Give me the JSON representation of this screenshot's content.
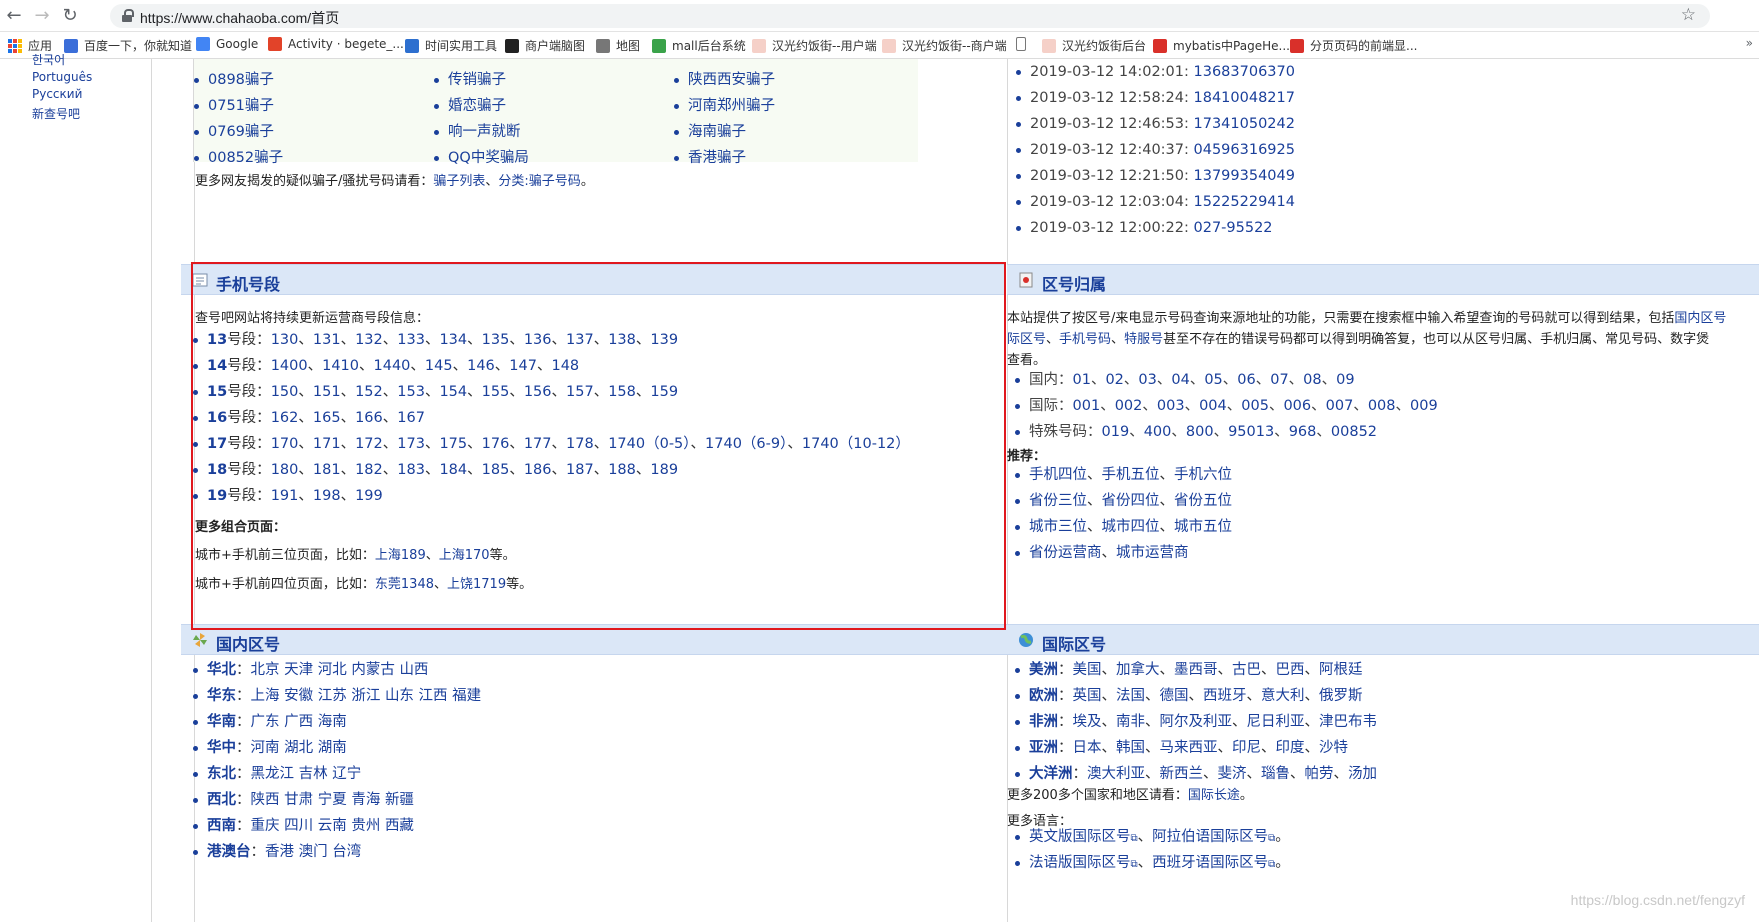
{
  "browser": {
    "url": "https://www.chahaoba.com/首页",
    "bookmarks": [
      "应用",
      "百度一下，你就知道",
      "Google",
      "Activity · begete_...",
      "时间实用工具",
      "商户端脑图",
      "地图",
      "mall后台系统",
      "汉光约饭街--用户端",
      "汉光约饭街--商户端",
      "",
      "汉光约饭街后台",
      "mybatis中PageHe...",
      "分页页码的前端显..."
    ],
    "more": "»"
  },
  "sidebar": {
    "languages": [
      "한국어",
      "Português",
      "Русский",
      "新查号吧"
    ]
  },
  "scam": {
    "col1": [
      "0898骗子",
      "0751骗子",
      "0769骗子",
      "00852骗子"
    ],
    "col2": [
      "传销骗子",
      "婚恋骗子",
      "响一声就断",
      "QQ中奖骗局"
    ],
    "col3": [
      "陕西西安骗子",
      "河南郑州骗子",
      "海南骗子",
      "香港骗子"
    ],
    "more_prefix": "更多网友揭发的疑似骗子/骚扰号码请看：",
    "more_link1": "骗子列表",
    "more_sep": "、",
    "more_link2": "分类:骗子号码",
    "more_suffix": "。"
  },
  "recent": {
    "items": [
      {
        "time": "2019-03-12 14:02:01:",
        "num": "13683706370"
      },
      {
        "time": "2019-03-12 12:58:24:",
        "num": "18410048217"
      },
      {
        "time": "2019-03-12 12:46:53:",
        "num": "17341050242"
      },
      {
        "time": "2019-03-12 12:40:37:",
        "num": "04596316925"
      },
      {
        "time": "2019-03-12 12:21:50:",
        "num": "13799354049"
      },
      {
        "time": "2019-03-12 12:03:04:",
        "num": "15225229414"
      },
      {
        "time": "2019-03-12 12:00:22:",
        "num": "027-95522"
      }
    ]
  },
  "mobile": {
    "title": "手机号段",
    "intro": "查号吧网站将持续更新运营商号段信息：",
    "segments": [
      {
        "key": "13",
        "label": "号段：",
        "values": [
          "130",
          "131",
          "132",
          "133",
          "134",
          "135",
          "136",
          "137",
          "138",
          "139"
        ]
      },
      {
        "key": "14",
        "label": "号段：",
        "values": [
          "1400",
          "1410",
          "1440",
          "145",
          "146",
          "147",
          "148"
        ]
      },
      {
        "key": "15",
        "label": "号段：",
        "values": [
          "150",
          "151",
          "152",
          "153",
          "154",
          "155",
          "156",
          "157",
          "158",
          "159"
        ]
      },
      {
        "key": "16",
        "label": "号段：",
        "values": [
          "162",
          "165",
          "166",
          "167"
        ]
      },
      {
        "key": "17",
        "label": "号段：",
        "values": [
          "170",
          "171",
          "172",
          "173",
          "175",
          "176",
          "177",
          "178",
          "1740（0-5）",
          "1740（6-9）",
          "1740（10-12）"
        ]
      },
      {
        "key": "18",
        "label": "号段：",
        "values": [
          "180",
          "181",
          "182",
          "183",
          "184",
          "185",
          "186",
          "187",
          "188",
          "189"
        ]
      },
      {
        "key": "19",
        "label": "号段：",
        "values": [
          "191",
          "198",
          "199"
        ]
      }
    ],
    "more_title": "更多组合页面：",
    "combo1_prefix": "城市+手机前三位页面，比如：",
    "combo1_link1": "上海189",
    "combo1_link2": "上海170",
    "combo1_suffix": "等。",
    "combo2_prefix": "城市+手机前四位页面，比如：",
    "combo2_link1": "东莞1348",
    "combo2_link2": "上饶1719",
    "combo2_suffix": "等。",
    "sep": "、"
  },
  "area": {
    "title": "区号归属",
    "desc1": "本站提供了按区号/来电显示号码查询来源地址的功能，只需要在搜索框中输入希望查询的号码就可以得到结果，包括",
    "desc1_link": "国内区号",
    "desc2_link1": "际区号",
    "desc2_sep1": "、",
    "desc2_link2": "手机号码",
    "desc2_sep2": "、",
    "desc2_link3": "特服号",
    "desc2_rest": "甚至不存在的错误号码都可以得到明确答复，也可以从区号归属、手机归属、常见号码、数字煲",
    "desc3": "查看。",
    "rows": [
      {
        "label": "国内：",
        "values": [
          "01",
          "02",
          "03",
          "04",
          "05",
          "06",
          "07",
          "08",
          "09"
        ]
      },
      {
        "label": "国际：",
        "values": [
          "001",
          "002",
          "003",
          "004",
          "005",
          "006",
          "007",
          "008",
          "009"
        ]
      },
      {
        "label": "特殊号码：",
        "values": [
          "019",
          "400",
          "800",
          "95013",
          "968",
          "00852"
        ]
      }
    ],
    "recommend_title": "推荐：",
    "recommend": [
      [
        "手机四位",
        "手机五位",
        "手机六位"
      ],
      [
        "省份三位",
        "省份四位",
        "省份五位"
      ],
      [
        "城市三位",
        "城市四位",
        "城市五位"
      ],
      [
        "省份运营商",
        "城市运营商"
      ]
    ]
  },
  "domestic": {
    "title": "国内区号",
    "regions": [
      {
        "key": "华北",
        "items": [
          "北京",
          "天津",
          "河北",
          "内蒙古",
          "山西"
        ]
      },
      {
        "key": "华东",
        "items": [
          "上海",
          "安徽",
          "江苏",
          "浙江",
          "山东",
          "江西",
          "福建"
        ]
      },
      {
        "key": "华南",
        "items": [
          "广东",
          "广西",
          "海南"
        ]
      },
      {
        "key": "华中",
        "items": [
          "河南",
          "湖北",
          "湖南"
        ]
      },
      {
        "key": "东北",
        "items": [
          "黑龙江",
          "吉林",
          "辽宁"
        ]
      },
      {
        "key": "西北",
        "items": [
          "陕西",
          "甘肃",
          "宁夏",
          "青海",
          "新疆"
        ]
      },
      {
        "key": "西南",
        "items": [
          "重庆",
          "四川",
          "云南",
          "贵州",
          "西藏"
        ]
      },
      {
        "key": "港澳台",
        "items": [
          "香港",
          "澳门",
          "台湾"
        ]
      }
    ]
  },
  "international": {
    "title": "国际区号",
    "continents": [
      {
        "key": "美洲",
        "items": [
          "美国",
          "加拿大",
          "墨西哥",
          "古巴",
          "巴西",
          "阿根廷"
        ]
      },
      {
        "key": "欧洲",
        "items": [
          "英国",
          "法国",
          "德国",
          "西班牙",
          "意大利",
          "俄罗斯"
        ]
      },
      {
        "key": "非洲",
        "items": [
          "埃及",
          "南非",
          "阿尔及利亚",
          "尼日利亚",
          "津巴布韦"
        ]
      },
      {
        "key": "亚洲",
        "items": [
          "日本",
          "韩国",
          "马来西亚",
          "印尼",
          "印度",
          "沙特"
        ]
      },
      {
        "key": "大洋洲",
        "items": [
          "澳大利亚",
          "新西兰",
          "斐济",
          "瑙鲁",
          "帕劳",
          "汤加"
        ]
      }
    ],
    "more_prefix": "更多200多个国家和地区请看：",
    "more_link": "国际长途",
    "more_suffix": "。",
    "lang_title": "更多语言：",
    "lang_rows": [
      [
        "英文版国际区号",
        "阿拉伯语国际区号"
      ],
      [
        "法语版国际区号",
        "西班牙语国际区号"
      ]
    ],
    "lang_sep": "、",
    "lang_suffix": "。"
  },
  "watermark": "https://blog.csdn.net/fengzyf",
  "colors": {
    "link": "#1a3f9a",
    "highlight": "#e0181e",
    "panel_head": "#dbe7f7"
  }
}
